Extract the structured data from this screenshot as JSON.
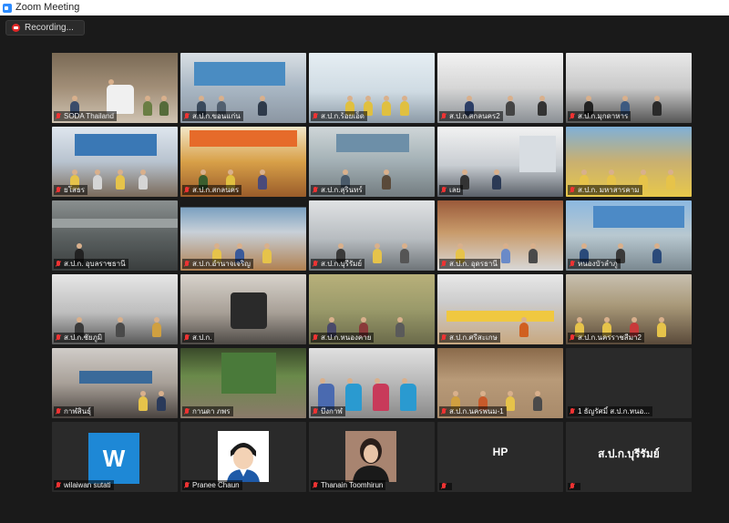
{
  "window": {
    "title": "Zoom Meeting"
  },
  "recording": {
    "label": "Recording..."
  },
  "tiles": [
    {
      "label": "SODA Thailand",
      "active": true
    },
    {
      "label": "ส.ป.ก.ขอนแก่น"
    },
    {
      "label": "ส.ป.ก.ร้อยเอ็ด"
    },
    {
      "label": "ส.ป.ก.สกลนคร2"
    },
    {
      "label": "ส.ป.ก.มุกดาหาร"
    },
    {
      "label": "ยโสธร"
    },
    {
      "label": "ส.ป.ก.สกลนคร"
    },
    {
      "label": "ส.ป.ก.สุรินทร์"
    },
    {
      "label": "เลย"
    },
    {
      "label": "ส.ป.ก. มหาสารคาม"
    },
    {
      "label": "ส.ป.ก. อุบลราชธานี"
    },
    {
      "label": "ส.ป.ก.อำนาจเจริญ"
    },
    {
      "label": "ส.ป.ก.บุรีรัมย์"
    },
    {
      "label": "ส.ป.ก. อุดรธานี"
    },
    {
      "label": "หนองบัวลำภู"
    },
    {
      "label": "ส.ป.ก.ชัยภูมิ"
    },
    {
      "label": "ส.ป.ก."
    },
    {
      "label": "ส.ป.ก.หนองคาย"
    },
    {
      "label": "ส.ป.ก.ศรีสะเกษ"
    },
    {
      "label": "ส.ป.ก.นครราชสีมา2"
    },
    {
      "label": "กาฬสินธุ์"
    },
    {
      "label": "กานดา ภพร"
    },
    {
      "label": "บึงกาฬ"
    },
    {
      "label": "ส.ป.ก.นครพนม-1"
    },
    {
      "label": "1 ธัญรัศมิ์ ส.ป.ก.หนอ..."
    },
    {
      "label": "wilaiwan sutati",
      "avatar_letter": "W"
    },
    {
      "label": "Pranee Chaun"
    },
    {
      "label": "Thanain Toomhirun"
    },
    {
      "label": "",
      "big_name": "HP"
    },
    {
      "label": "",
      "big_name": "ส.ป.ก.บุรีรัมย์"
    }
  ],
  "colors": {
    "active_border": "#c8d400",
    "background": "#1a1a1a",
    "avatar_w": "#1e88d6"
  }
}
